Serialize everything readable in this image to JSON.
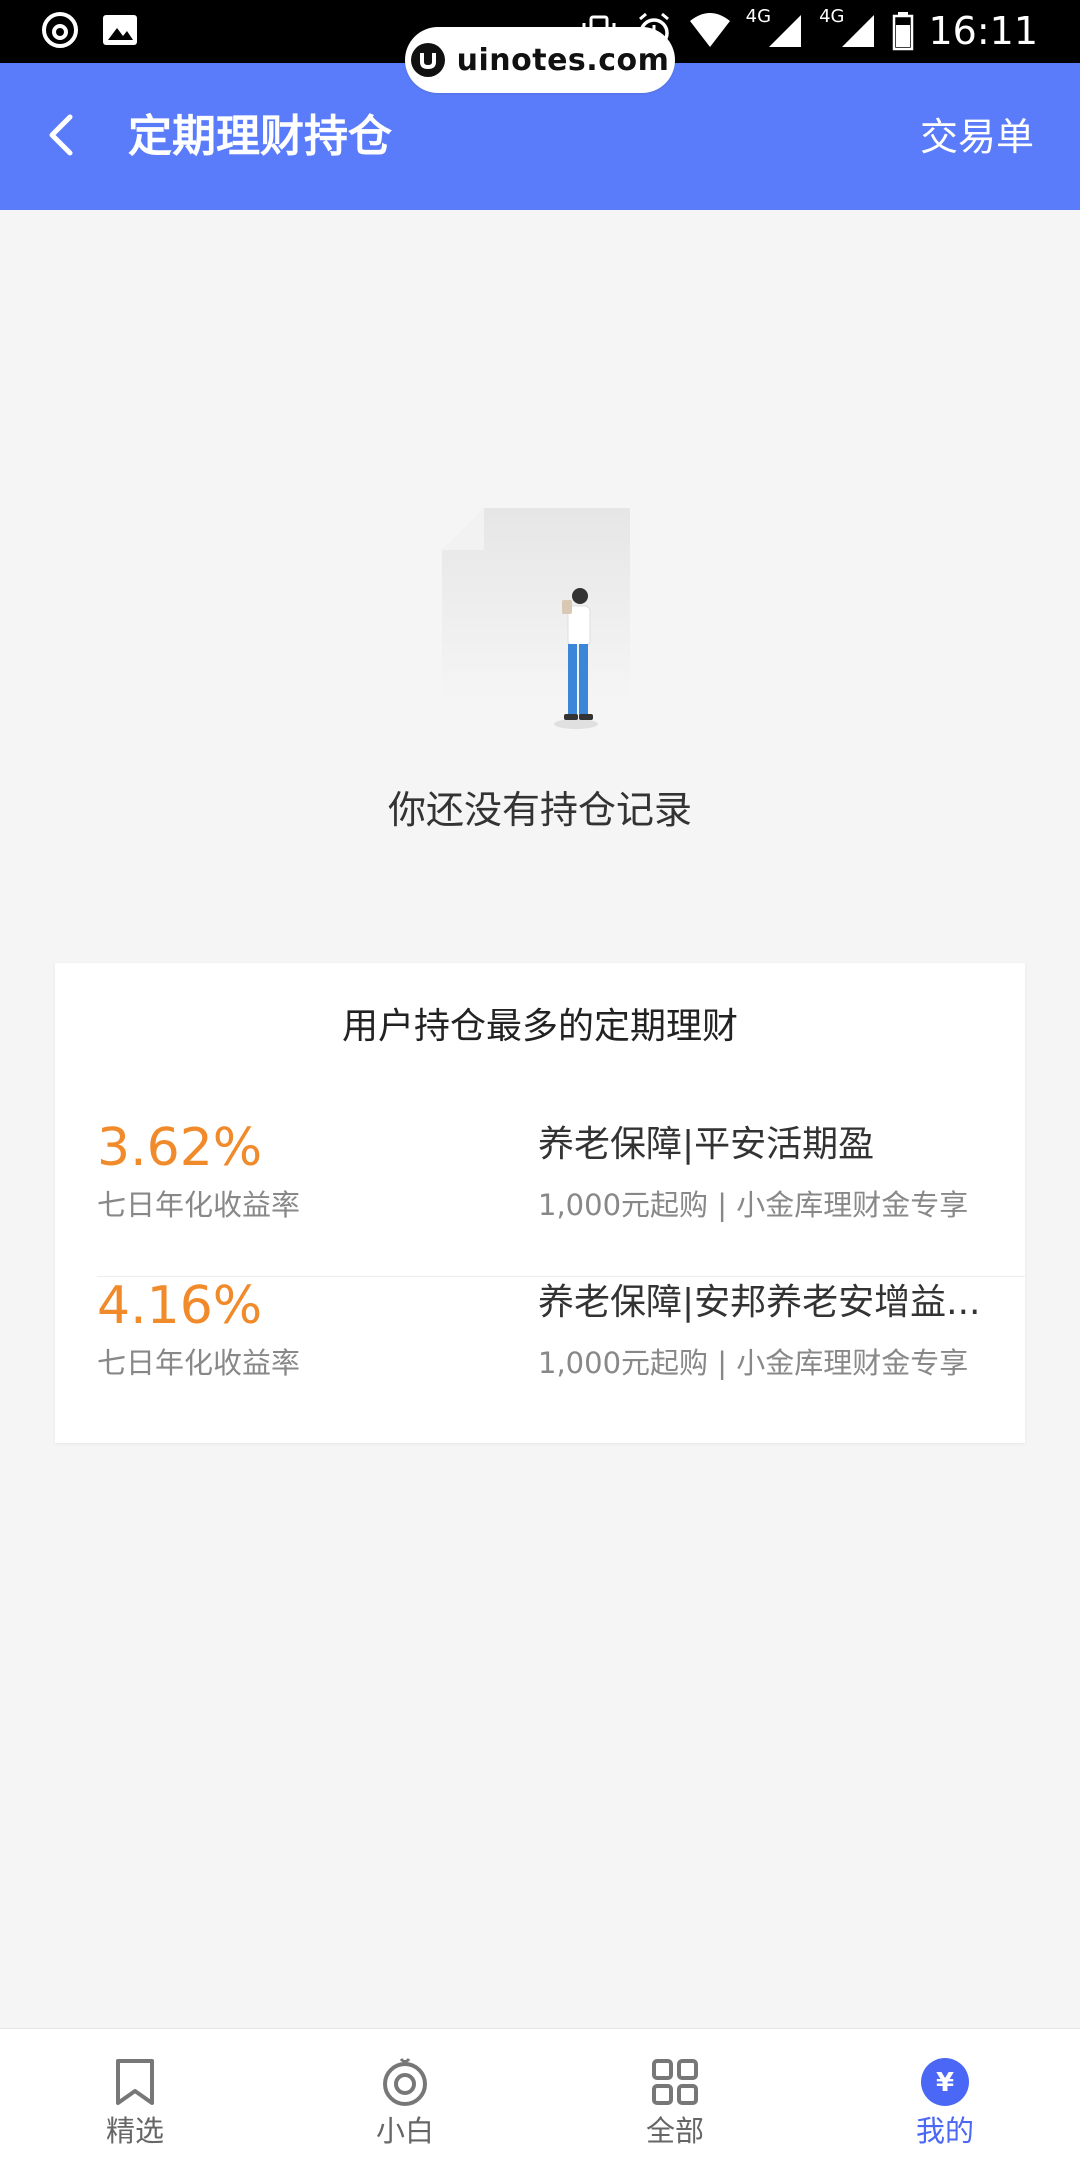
{
  "status_bar": {
    "time": "16:11",
    "network_1": "4G",
    "network_2": "4G",
    "icons": [
      "netease-cloud-music-icon",
      "image-icon",
      "vibrate-icon",
      "alarm-icon",
      "wifi-icon",
      "signal-icon",
      "battery-icon"
    ]
  },
  "watermark": {
    "text": "uinotes.com"
  },
  "header": {
    "title": "定期理财持仓",
    "action": "交易单",
    "background": "#5b7cfa"
  },
  "empty_state": {
    "text": "你还没有持仓记录"
  },
  "card": {
    "title": "用户持仓最多的定期理财",
    "products": [
      {
        "rate": "3.62%",
        "rate_label": "七日年化收益率",
        "name": "养老保障|平安活期盈",
        "desc": "1,000元起购 | 小金库理财金专享"
      },
      {
        "rate": "4.16%",
        "rate_label": "七日年化收益率",
        "name": "养老保障|安邦养老安增益...",
        "desc": "1,000元起购 | 小金库理财金专享"
      }
    ],
    "rate_color": "#f08a2a"
  },
  "bottom_nav": {
    "items": [
      {
        "label": "精选",
        "icon": "bookmark-icon"
      },
      {
        "label": "小白",
        "icon": "target-icon"
      },
      {
        "label": "全部",
        "icon": "grid-icon"
      },
      {
        "label": "我的",
        "icon": "yuan-icon",
        "active": true
      }
    ],
    "active_color": "#4a67f5"
  }
}
